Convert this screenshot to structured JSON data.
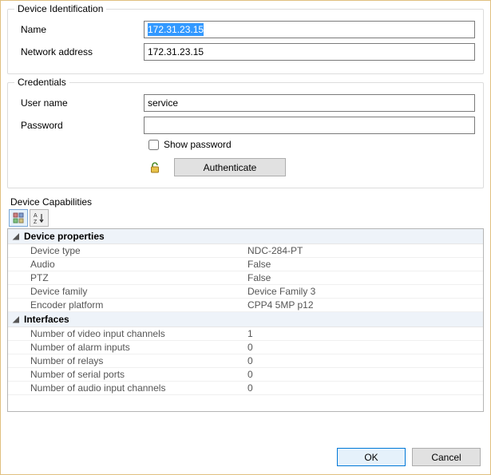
{
  "identification": {
    "legend": "Device Identification",
    "name_label": "Name",
    "name_value": "172.31.23.15",
    "netaddr_label": "Network address",
    "netaddr_value": "172.31.23.15"
  },
  "credentials": {
    "legend": "Credentials",
    "user_label": "User name",
    "user_value": "service",
    "pass_label": "Password",
    "pass_value": "",
    "show_pass_label": "Show password",
    "authenticate_label": "Authenticate"
  },
  "capabilities": {
    "title": "Device Capabilities",
    "groups": [
      {
        "name": "Device properties",
        "rows": [
          {
            "k": "Device type",
            "v": "NDC-284-PT"
          },
          {
            "k": "Audio",
            "v": "False"
          },
          {
            "k": "PTZ",
            "v": "False"
          },
          {
            "k": "Device family",
            "v": "Device Family 3"
          },
          {
            "k": "Encoder platform",
            "v": "CPP4 5MP p12"
          }
        ]
      },
      {
        "name": "Interfaces",
        "rows": [
          {
            "k": "Number of video input channels",
            "v": "1"
          },
          {
            "k": "Number of alarm inputs",
            "v": "0"
          },
          {
            "k": "Number of relays",
            "v": "0"
          },
          {
            "k": "Number of serial ports",
            "v": "0"
          },
          {
            "k": "Number of audio input channels",
            "v": "0"
          }
        ]
      }
    ]
  },
  "buttons": {
    "ok": "OK",
    "cancel": "Cancel"
  }
}
